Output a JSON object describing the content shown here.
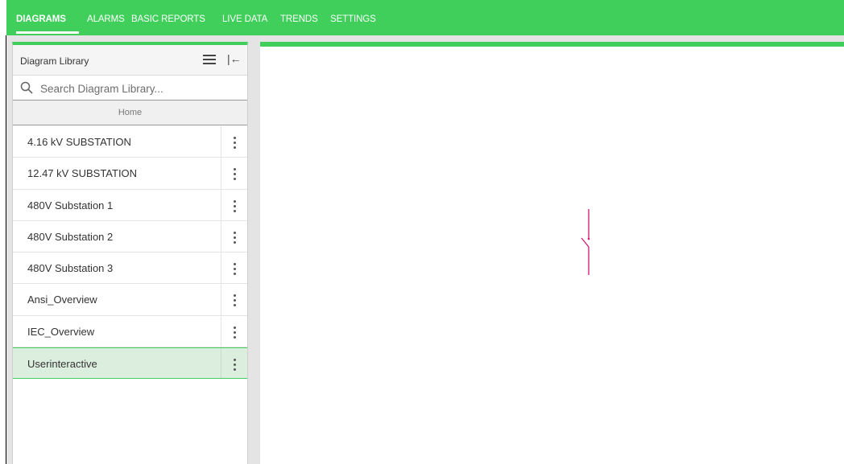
{
  "topnav": {
    "tabs": [
      {
        "label": "DIAGRAMS",
        "active": true
      },
      {
        "label": "ALARMS"
      },
      {
        "label": "BASIC REPORTS"
      },
      {
        "label": "LIVE DATA"
      },
      {
        "label": "TRENDS"
      },
      {
        "label": "SETTINGS"
      }
    ],
    "accent_color": "#3fcf5a"
  },
  "library": {
    "title": "Diagram Library",
    "menu_icon": "hamburger-menu-icon",
    "collapse_icon": "collapse-left-icon",
    "search": {
      "placeholder": "Search Diagram Library...",
      "value": ""
    },
    "folder": "Home",
    "items": [
      {
        "label": "4.16 kV SUBSTATION"
      },
      {
        "label": "12.47 kV SUBSTATION"
      },
      {
        "label": "480V Substation 1"
      },
      {
        "label": "480V Substation 2"
      },
      {
        "label": "480V Substation 3"
      },
      {
        "label": "Ansi_Overview"
      },
      {
        "label": "IEC_Overview"
      },
      {
        "label": "Userinteractive",
        "selected": true
      }
    ]
  },
  "canvas": {
    "symbol": "open-switch-symbol",
    "symbol_color": "#d4157a"
  }
}
